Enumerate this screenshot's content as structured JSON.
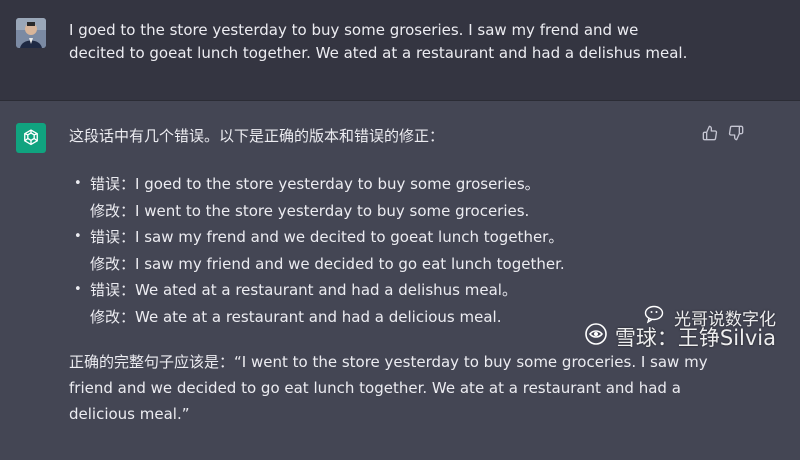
{
  "user_message": {
    "text": "I goed to the store yesterday to buy some groseries. I saw my frend and we decited to goeat lunch together. We ated at a restaurant and had a delishus meal."
  },
  "assistant_message": {
    "intro": "这段话中有几个错误。以下是正确的版本和错误的修正：",
    "bullet": "•",
    "corrections": [
      {
        "error": "错误：I goed to the store yesterday to buy some groseries。",
        "fix": "修改：I went to the store yesterday to buy some groceries."
      },
      {
        "error": "错误：I saw my frend and we decited to goeat lunch together。",
        "fix": "修改：I saw my friend and we decided to go eat lunch together."
      },
      {
        "error": "错误：We ated at a restaurant and had a delishus meal。",
        "fix": "修改：We ate at a restaurant and had a delicious meal."
      }
    ],
    "final": "正确的完整句子应该是：“I went to the store yesterday to buy some groceries. I saw my friend and we decided to go eat lunch together. We ate at a restaurant and had a delicious meal.”"
  },
  "feedback": {
    "thumbs_up_icon": "thumbs-up-icon",
    "thumbs_down_icon": "thumbs-down-icon"
  },
  "watermark": {
    "line1": "光哥说数字化",
    "line2": "雪球：王铮Silvia"
  },
  "colors": {
    "user_bg": "#343541",
    "assistant_bg": "#444654",
    "gpt_avatar": "#10a37f",
    "text": "#ececf1"
  }
}
